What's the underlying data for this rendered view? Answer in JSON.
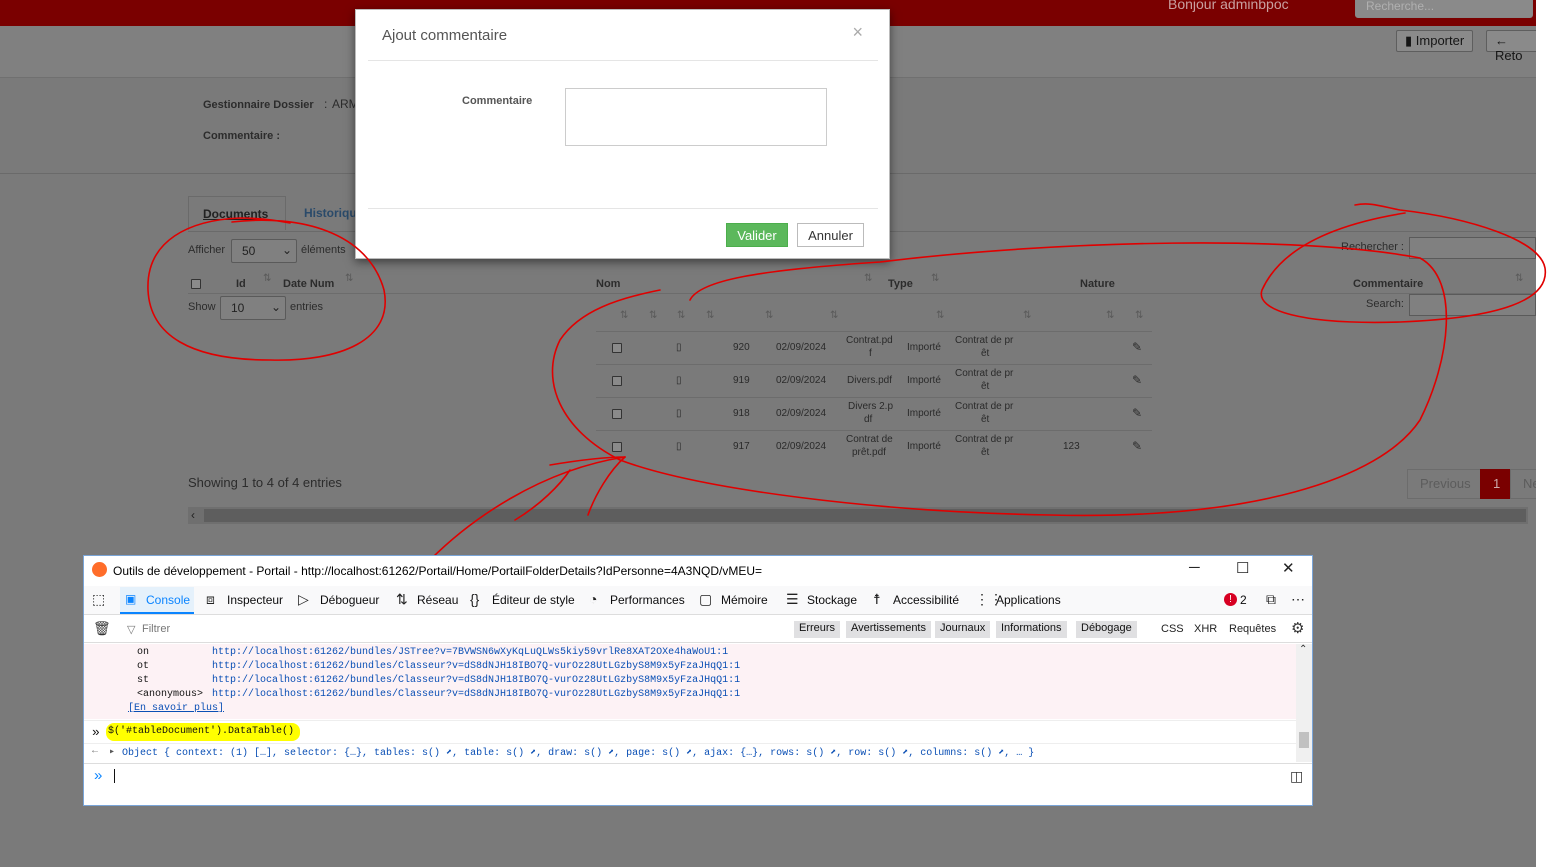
{
  "topbar": {
    "greeting": "Bonjour adminbpoc",
    "search_placeholder": "Recherche..."
  },
  "toolbar": {
    "import_label": "Importer",
    "back_label": "Reto"
  },
  "info": {
    "manager_label": "Gestionnaire Dossier",
    "manager_value": "ARM",
    "comment_label": "Commentaire :"
  },
  "tabs": [
    {
      "label": "Documents"
    },
    {
      "label": "Historiqu"
    }
  ],
  "table_controls": {
    "show_label": "Afficher",
    "show_value": "50",
    "elements_label": "éléments",
    "show2_label": "Show",
    "show2_value": "10",
    "entries_label": "entries",
    "search_label": "Rechercher :",
    "search2_label": "Search:"
  },
  "columns": {
    "id": "Id",
    "date": "Date Num",
    "nom": "Nom",
    "type": "Type",
    "nature": "Nature",
    "comment": "Commentaire"
  },
  "rows": [
    {
      "id": "920",
      "date": "02/09/2024",
      "nom1": "Contrat.pd",
      "nom2": "f",
      "etat": "Importé",
      "nat1": "Contrat de pr",
      "nat2": "êt",
      "comment": ""
    },
    {
      "id": "919",
      "date": "02/09/2024",
      "nom1": "Divers.pdf",
      "nom2": "",
      "etat": "Importé",
      "nat1": "Contrat de pr",
      "nat2": "êt",
      "comment": ""
    },
    {
      "id": "918",
      "date": "02/09/2024",
      "nom1": "Divers 2.p",
      "nom2": "df",
      "etat": "Importé",
      "nat1": "Contrat de pr",
      "nat2": "êt",
      "comment": ""
    },
    {
      "id": "917",
      "date": "02/09/2024",
      "nom1": "Contrat de",
      "nom2": "prêt.pdf",
      "etat": "Importé",
      "nat1": "Contrat de pr",
      "nat2": "êt",
      "comment": "123"
    }
  ],
  "footer": {
    "showing": "Showing 1 to 4 of 4 entries",
    "previous": "Previous",
    "page": "1",
    "next": "Ne"
  },
  "modal": {
    "title": "Ajout commentaire",
    "close": "×",
    "field_label": "Commentaire",
    "ok": "Valider",
    "cancel": "Annuler"
  },
  "devtools": {
    "title": "Outils de développement - Portail - http://localhost:61262/Portail/Home/PortailFolderDetails?IdPersonne=4A3NQD/vMEU=",
    "tabs": [
      "Console",
      "Inspecteur",
      "Débogueur",
      "Réseau",
      "Éditeur de style",
      "Performances",
      "Mémoire",
      "Stockage",
      "Accessibilité",
      "Applications"
    ],
    "error_count": "2",
    "filter_placeholder": "Filtrer",
    "filters": [
      "Erreurs",
      "Avertissements",
      "Journaux",
      "Informations",
      "Débogage"
    ],
    "filters2": [
      "CSS",
      "XHR",
      "Requêtes"
    ],
    "stack": [
      {
        "fn": "on",
        "url": "http://localhost:61262/bundles/JSTree?v=7BVWSN6wXyKqLuQLWs5kiy59vrlRe8XAT2OXe4haWoU1:1"
      },
      {
        "fn": "ot",
        "url": "http://localhost:61262/bundles/Classeur?v=dS8dNJH18IBO7Q-vurOz28UtLGzbyS8M9x5yFzaJHqQ1:1"
      },
      {
        "fn": "st",
        "url": "http://localhost:61262/bundles/Classeur?v=dS8dNJH18IBO7Q-vurOz28UtLGzbyS8M9x5yFzaJHqQ1:1"
      },
      {
        "fn": "<anonymous>",
        "url": "http://localhost:61262/bundles/Classeur?v=dS8dNJH18IBO7Q-vurOz28UtLGzbyS8M9x5yFzaJHqQ1:1"
      }
    ],
    "learn_more": "[En savoir plus]",
    "command": "$('#tableDocument').DataTable()",
    "result": "Object { context: (1) […], selector: {…}, tables: s() ⬈, table: s() ⬈, draw: s() ⬈, page: s() ⬈, ajax: {…}, rows: s() ⬈, row: s() ⬈, columns: s() ⬈, … }"
  }
}
